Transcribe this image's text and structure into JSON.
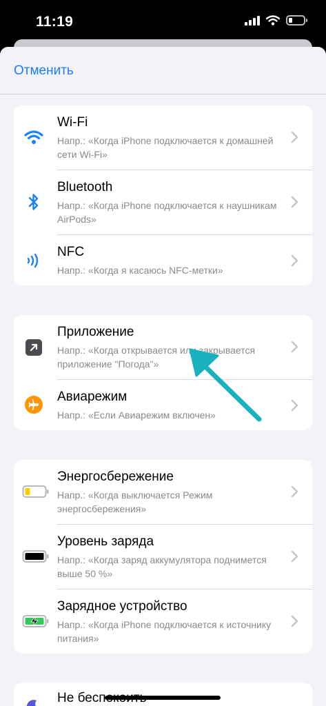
{
  "status_bar": {
    "time": "11:19"
  },
  "header": {
    "cancel_label": "Отменить"
  },
  "groups": [
    {
      "items": [
        {
          "title": "Wi-Fi",
          "subtitle": "Напр.: «Когда iPhone подключается к домашней сети Wi-Fi»",
          "icon": "wifi-icon"
        },
        {
          "title": "Bluetooth",
          "subtitle": "Напр.: «Когда iPhone подключается к наушникам AirPods»",
          "icon": "bluetooth-icon"
        },
        {
          "title": "NFC",
          "subtitle": "Напр.: «Когда я касаюсь NFC-метки»",
          "icon": "nfc-icon"
        }
      ]
    },
    {
      "items": [
        {
          "title": "Приложение",
          "subtitle": "Напр.: «Когда открывается или закрывается приложение \"Погода\"»",
          "icon": "app-arrow-icon"
        },
        {
          "title": "Авиарежим",
          "subtitle": "Напр.: «Если Авиарежим включен»",
          "icon": "airplane-icon"
        }
      ]
    },
    {
      "items": [
        {
          "title": "Энергосбережение",
          "subtitle": "Напр.: «Когда выключается Режим энергосбережения»",
          "icon": "low-power-battery-icon"
        },
        {
          "title": "Уровень заряда",
          "subtitle": "Напр.: «Когда заряд аккумулятора поднимется выше 50 %»",
          "icon": "battery-level-icon"
        },
        {
          "title": "Зарядное устройство",
          "subtitle": "Напр.: «Когда iPhone подключается к источнику питания»",
          "icon": "charging-battery-icon"
        }
      ]
    },
    {
      "items": [
        {
          "title": "Не беспокоить",
          "icon": "moon-icon"
        }
      ]
    }
  ],
  "colors": {
    "accent": "#1b7ff5",
    "airplane": "#ff9500",
    "app_icon": "#4a4a4f",
    "low_power": "#ffcc00",
    "charging": "#34c759",
    "annotation_arrow": "#1ab1bf"
  }
}
